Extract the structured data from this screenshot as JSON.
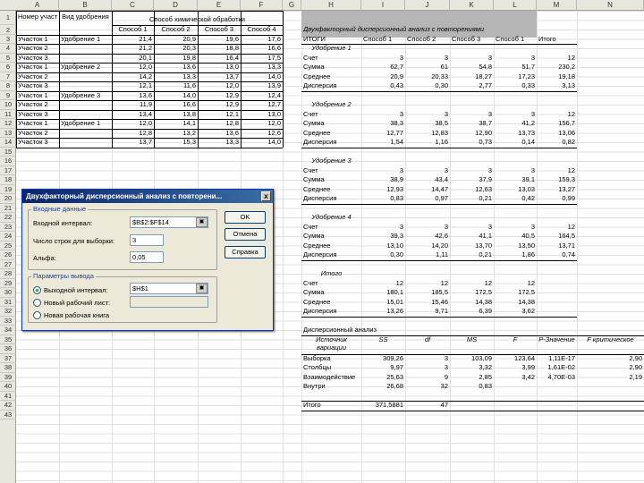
{
  "columns": [
    "A",
    "B",
    "C",
    "D",
    "E",
    "F",
    "G",
    "H",
    "I",
    "J",
    "K",
    "L",
    "M",
    "N"
  ],
  "rows": [
    "1",
    "2",
    "3",
    "4",
    "5",
    "6",
    "7",
    "8",
    "9",
    "10",
    "11",
    "12",
    "13",
    "14",
    "15",
    "16",
    "17",
    "18",
    "19",
    "20",
    "21",
    "22",
    "23",
    "24",
    "25",
    "26",
    "27",
    "28",
    "29",
    "30",
    "31",
    "32",
    "33",
    "34",
    "35",
    "36",
    "37",
    "38",
    "39",
    "40",
    "41",
    "42",
    "43"
  ],
  "left_table": {
    "hdr_num": "Номер участка",
    "hdr_type": "Вид удобрения",
    "hdr_method": "Способ химической обработки",
    "methods": [
      "Способ 1",
      "Способ 2",
      "Способ 3",
      "Способ 4"
    ],
    "rows": [
      {
        "plot": "Участок 1",
        "fert": "Удобрение 1",
        "v": [
          "21,4",
          "20,9",
          "19,6",
          "17,6"
        ]
      },
      {
        "plot": "Участок 2",
        "fert": "",
        "v": [
          "21,2",
          "20,3",
          "18,8",
          "16,6"
        ]
      },
      {
        "plot": "Участок 3",
        "fert": "",
        "v": [
          "20,1",
          "19,8",
          "16,4",
          "17,5"
        ]
      },
      {
        "plot": "Участок 1",
        "fert": "Удобрение 2",
        "v": [
          "12,0",
          "13,6",
          "13,0",
          "13,3"
        ]
      },
      {
        "plot": "Участок 2",
        "fert": "",
        "v": [
          "14,2",
          "13,3",
          "13,7",
          "14,0"
        ]
      },
      {
        "plot": "Участок 3",
        "fert": "",
        "v": [
          "12,1",
          "11,6",
          "12,0",
          "13,9"
        ]
      },
      {
        "plot": "Участок 1",
        "fert": "Удобрение 3",
        "v": [
          "13,6",
          "14,0",
          "12,9",
          "12,4"
        ]
      },
      {
        "plot": "Участок 2",
        "fert": "",
        "v": [
          "11,9",
          "16,6",
          "12,9",
          "12,7"
        ]
      },
      {
        "plot": "Участок 3",
        "fert": "",
        "v": [
          "13,4",
          "13,8",
          "12,1",
          "13,0"
        ]
      },
      {
        "plot": "Участок 1",
        "fert": "Удобрение 1",
        "v": [
          "12,0",
          "14,1",
          "12,8",
          "12,0"
        ]
      },
      {
        "plot": "Участок 2",
        "fert": "",
        "v": [
          "12,8",
          "13,2",
          "13,6",
          "12,6"
        ]
      },
      {
        "plot": "Участок 3",
        "fert": "",
        "v": [
          "13,7",
          "15,3",
          "13,3",
          "14,0"
        ]
      }
    ]
  },
  "result": {
    "title": "Двухфакторный дисперсионный анализ с повторениями",
    "hdr_itogi": "ИТОГИ",
    "hdr_cols": [
      "Способ 1",
      "Способ 2",
      "Способ 3",
      "Способ 1",
      "Итого"
    ],
    "blocks": [
      {
        "name": "Удобрение 1",
        "rows": [
          {
            "l": "Счет",
            "v": [
              "3",
              "3",
              "3",
              "3",
              "12"
            ]
          },
          {
            "l": "Сумма",
            "v": [
              "62,7",
              "61",
              "54,8",
              "51,7",
              "230,2"
            ]
          },
          {
            "l": "Среднее",
            "v": [
              "20,9",
              "20,33",
              "18,27",
              "17,23",
              "19,18"
            ]
          },
          {
            "l": "Дисперсия",
            "v": [
              "0,43",
              "0,30",
              "2,77",
              "0,33",
              "3,13"
            ]
          }
        ]
      },
      {
        "name": "Удобрение 2",
        "rows": [
          {
            "l": "Счет",
            "v": [
              "3",
              "3",
              "3",
              "3",
              "12"
            ]
          },
          {
            "l": "Сумма",
            "v": [
              "38,3",
              "38,5",
              "38,7",
              "41,2",
              "156,7"
            ]
          },
          {
            "l": "Среднее",
            "v": [
              "12,77",
              "12,83",
              "12,90",
              "13,73",
              "13,06"
            ]
          },
          {
            "l": "Дисперсия",
            "v": [
              "1,54",
              "1,16",
              "0,73",
              "0,14",
              "0,82"
            ]
          }
        ]
      },
      {
        "name": "Удобрение 3",
        "rows": [
          {
            "l": "Счет",
            "v": [
              "3",
              "3",
              "3",
              "3",
              "12"
            ]
          },
          {
            "l": "Сумма",
            "v": [
              "38,9",
              "43,4",
              "37,9",
              "39,1",
              "159,3"
            ]
          },
          {
            "l": "Среднее",
            "v": [
              "12,93",
              "14,47",
              "12,63",
              "13,03",
              "13,27"
            ]
          },
          {
            "l": "Дисперсия",
            "v": [
              "0,83",
              "0,97",
              "0,21",
              "0,42",
              "0,99"
            ]
          }
        ]
      },
      {
        "name": "Удобрение 4",
        "rows": [
          {
            "l": "Счет",
            "v": [
              "3",
              "3",
              "3",
              "3",
              "12"
            ]
          },
          {
            "l": "Сумма",
            "v": [
              "39,3",
              "42,6",
              "41,1",
              "40,5",
              "164,5"
            ]
          },
          {
            "l": "Среднее",
            "v": [
              "13,10",
              "14,20",
              "13,70",
              "13,50",
              "13,71"
            ]
          },
          {
            "l": "Дисперсия",
            "v": [
              "0,30",
              "1,11",
              "0,21",
              "1,86",
              "0,74"
            ]
          }
        ]
      },
      {
        "name": "Итого",
        "rows": [
          {
            "l": "Счет",
            "v": [
              "12",
              "12",
              "12",
              "12",
              ""
            ]
          },
          {
            "l": "Сумма",
            "v": [
              "180,1",
              "185,5",
              "172,5",
              "172,5",
              ""
            ]
          },
          {
            "l": "Среднее",
            "v": [
              "15,01",
              "15,46",
              "14,38",
              "14,38",
              ""
            ]
          },
          {
            "l": "Дисперсия",
            "v": [
              "13,26",
              "9,71",
              "6,39",
              "3,62",
              ""
            ]
          }
        ]
      }
    ],
    "anova_title": "Дисперсионный анализ",
    "anova_hdr": [
      "Источник вариации",
      "SS",
      "df",
      "MS",
      "F",
      "P-Значение",
      "F критическое"
    ],
    "anova_rows": [
      {
        "l": "Выборка",
        "v": [
          "309,26",
          "3",
          "103,09",
          "123,64",
          "1,11E-17",
          "2,90"
        ]
      },
      {
        "l": "Столбцы",
        "v": [
          "9,97",
          "3",
          "3,32",
          "3,99",
          "1,61E-02",
          "2,90"
        ]
      },
      {
        "l": "Взаимодействие",
        "v": [
          "25,63",
          "9",
          "2,85",
          "3,42",
          "4,70E-03",
          "2,19"
        ]
      },
      {
        "l": "Внутри",
        "v": [
          "26,68",
          "32",
          "0,83",
          "",
          "",
          ""
        ]
      }
    ],
    "total_label": "Итого",
    "total_ss": "371,5881",
    "total_df": "47"
  },
  "dialog": {
    "title": "Двухфакторный дисперсионный анализ с повторени...",
    "close": "x",
    "input_group": "Входные данные",
    "input_range_label": "Входной интервал:",
    "input_range": "$B$2:$F$14",
    "rows_label": "Число строк для выборки:",
    "rows_value": "3",
    "alpha_label": "Альфа:",
    "alpha_value": "0,05",
    "output_group": "Параметры вывода",
    "out_range_label": "Выходной интервал:",
    "out_range": "$H$1",
    "new_sheet_label": "Новый рабочий лист:",
    "new_book_label": "Новая рабочая книга",
    "ok": "OK",
    "cancel": "Отмена",
    "help": "Справка",
    "pick": "▣"
  }
}
